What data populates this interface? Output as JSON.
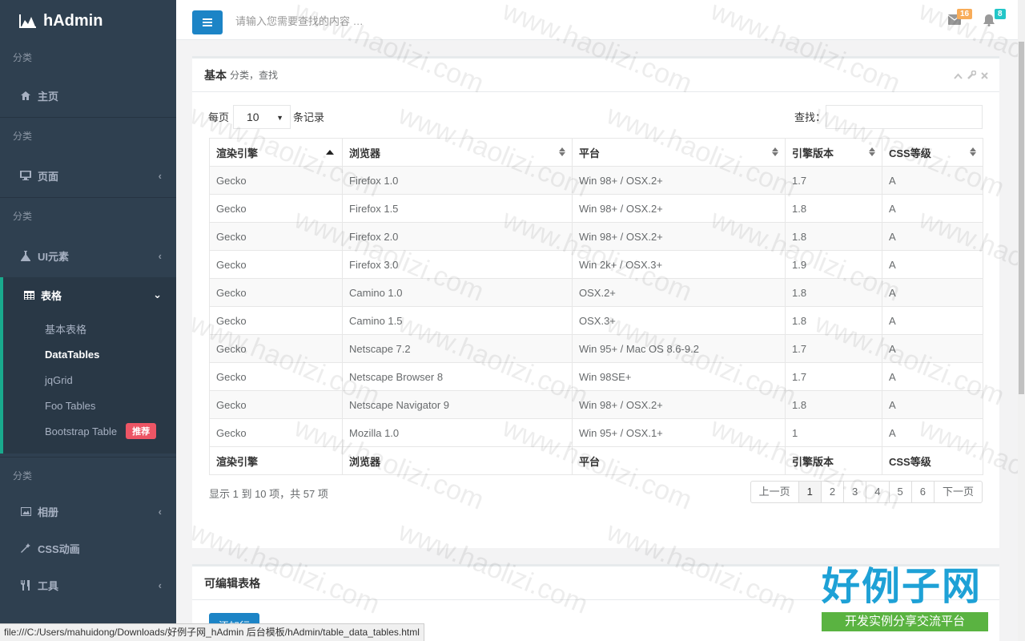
{
  "app": {
    "name": "hAdmin"
  },
  "sidebar": {
    "section_label": "分类",
    "items": [
      {
        "label": "主页",
        "icon": "home-icon"
      },
      {
        "label": "页面",
        "icon": "desktop-icon"
      },
      {
        "label": "UI元素",
        "icon": "flask-icon"
      },
      {
        "label": "表格",
        "icon": "table-icon"
      },
      {
        "label": "相册",
        "icon": "picture-icon"
      },
      {
        "label": "CSS动画",
        "icon": "magic-icon"
      },
      {
        "label": "工具",
        "icon": "cutlery-icon"
      }
    ],
    "submenu": [
      {
        "label": "基本表格"
      },
      {
        "label": "DataTables"
      },
      {
        "label": "jqGrid"
      },
      {
        "label": "Foo Tables"
      },
      {
        "label": "Bootstrap Table",
        "badge": "推荐"
      }
    ]
  },
  "topbar": {
    "search_placeholder": "请输入您需要查找的内容 …",
    "mail_count": "16",
    "alert_count": "8"
  },
  "panel": {
    "title": "基本",
    "subtitle": "分类，查找",
    "length_prefix": "每页",
    "length_value": "10",
    "length_suffix": "条记录",
    "search_label": "查找："
  },
  "table": {
    "columns": [
      "渲染引擎",
      "浏览器",
      "平台",
      "引擎版本",
      "CSS等级"
    ],
    "rows": [
      [
        "Gecko",
        "Firefox 1.0",
        "Win 98+ / OSX.2+",
        "1.7",
        "A"
      ],
      [
        "Gecko",
        "Firefox 1.5",
        "Win 98+ / OSX.2+",
        "1.8",
        "A"
      ],
      [
        "Gecko",
        "Firefox 2.0",
        "Win 98+ / OSX.2+",
        "1.8",
        "A"
      ],
      [
        "Gecko",
        "Firefox 3.0",
        "Win 2k+ / OSX.3+",
        "1.9",
        "A"
      ],
      [
        "Gecko",
        "Camino 1.0",
        "OSX.2+",
        "1.8",
        "A"
      ],
      [
        "Gecko",
        "Camino 1.5",
        "OSX.3+",
        "1.8",
        "A"
      ],
      [
        "Gecko",
        "Netscape 7.2",
        "Win 95+ / Mac OS 8.6-9.2",
        "1.7",
        "A"
      ],
      [
        "Gecko",
        "Netscape Browser 8",
        "Win 98SE+",
        "1.7",
        "A"
      ],
      [
        "Gecko",
        "Netscape Navigator 9",
        "Win 98+ / OSX.2+",
        "1.8",
        "A"
      ],
      [
        "Gecko",
        "Mozilla 1.0",
        "Win 95+ / OSX.1+",
        "1",
        "A"
      ]
    ]
  },
  "footer": {
    "info": "显示 1 到 10 项，共 57 项",
    "prev": "上一页",
    "next": "下一页",
    "pages": [
      "1",
      "2",
      "3",
      "4",
      "5",
      "6"
    ]
  },
  "panel2": {
    "title": "可编辑表格",
    "add_button": "添加行"
  },
  "watermark": {
    "text": "www.haolizi.com",
    "logo_main": "好例子网",
    "logo_tagline": "开发实例分享交流平台"
  },
  "statusbar": {
    "url": "file:///C:/Users/mahuidong/Downloads/好例子网_hAdmin 后台模板/hAdmin/table_data_tables.html"
  },
  "colors": {
    "sidebar_bg": "#2f4050",
    "accent_green": "#19aa8d",
    "primary_blue": "#1c84c6",
    "badge_red": "#ed5565",
    "mail_badge": "#f8ac59",
    "alert_badge": "#23c6c8"
  }
}
